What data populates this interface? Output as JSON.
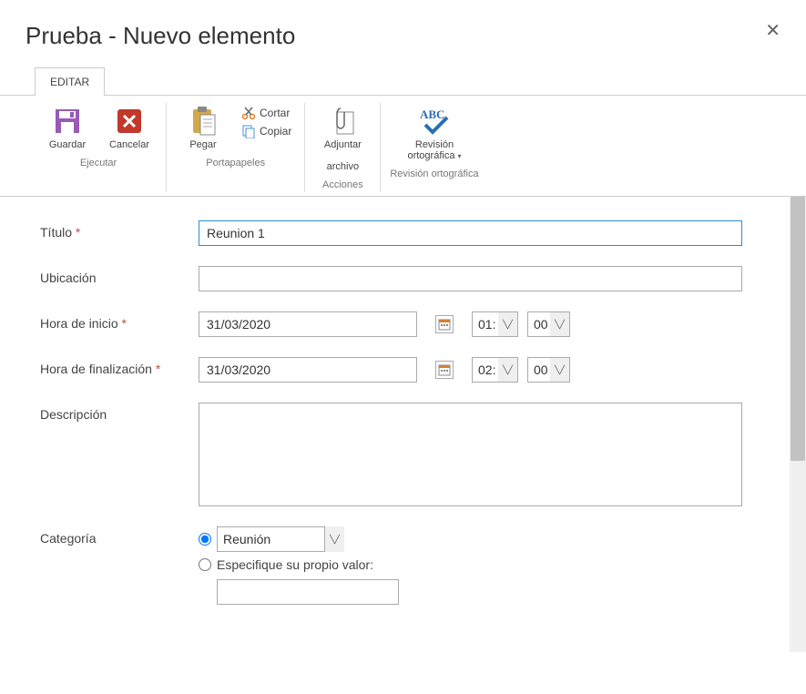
{
  "dialog": {
    "title": "Prueba - Nuevo elemento"
  },
  "tabs": {
    "edit": "EDITAR"
  },
  "ribbon": {
    "save": "Guardar",
    "cancel": "Cancelar",
    "paste": "Pegar",
    "cut": "Cortar",
    "copy": "Copiar",
    "attach_l1": "Adjuntar",
    "attach_l2": "archivo",
    "spell_l1": "Revisión",
    "spell_l2": "ortográfica",
    "group_exec": "Ejecutar",
    "group_clip": "Portapapeles",
    "group_actions": "Acciones",
    "group_spell": "Revisión ortográfica"
  },
  "form": {
    "title_label": "Título",
    "title_value": "Reunion 1",
    "location_label": "Ubicación",
    "location_value": "",
    "start_label": "Hora de inicio",
    "start_date": "31/03/2020",
    "start_hour": "01:",
    "start_min": "00",
    "end_label": "Hora de finalización",
    "end_date": "31/03/2020",
    "end_hour": "02:",
    "end_min": "00",
    "desc_label": "Descripción",
    "desc_value": "",
    "cat_label": "Categoría",
    "cat_selected": "Reunión",
    "cat_custom_label": "Especifique su propio valor:",
    "cat_custom_value": ""
  }
}
